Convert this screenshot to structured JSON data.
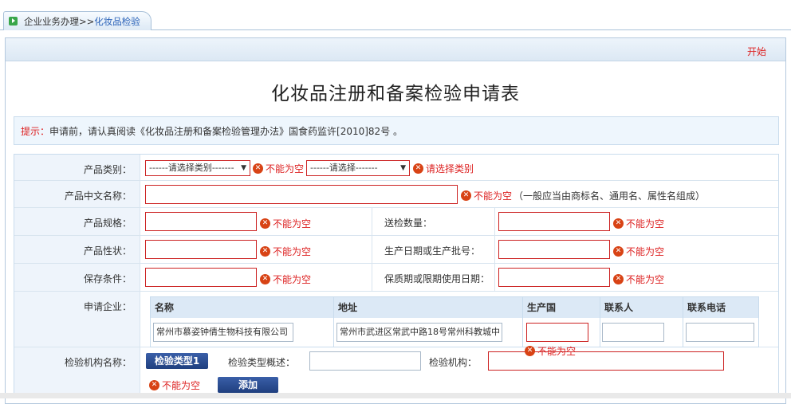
{
  "tab": {
    "crumb": "企业业务办理>>",
    "current": "化妆品检验"
  },
  "toolbar": {
    "start_label": "开始"
  },
  "title": "化妆品注册和备案检验申请表",
  "notice": {
    "label": "提示：",
    "text": "申请前，请认真阅读《化妆品注册和备案检验管理办法》国食药监许[2010]82号 。"
  },
  "errors": {
    "required": "不能为空",
    "select_category": "请选择类别"
  },
  "form": {
    "category": {
      "label": "产品类别：",
      "select1": "------请选择类别-------",
      "select2": "------请选择-------"
    },
    "cn_name": {
      "label": "产品中文名称：",
      "hint": "（一般应当由商标名、通用名、属性名组成）"
    },
    "spec": {
      "label": "产品规格："
    },
    "qty": {
      "label": "送检数量："
    },
    "nature": {
      "label": "产品性状："
    },
    "batch": {
      "label": "生产日期或生产批号："
    },
    "storage": {
      "label": "保存条件："
    },
    "shelf": {
      "label": "保质期或限期使用日期："
    },
    "company": {
      "label": "申请企业：",
      "headers": [
        "名称",
        "地址",
        "生产国",
        "联系人",
        "联系电话"
      ],
      "name_value": "常州市慕姿钟倩生物科技有限公司",
      "address_value": "常州市武进区常武中路18号常州科教城中"
    },
    "agency": {
      "label": "检验机构名称：",
      "type_button": "检验类型1",
      "type_desc_label": "检验类型概述：",
      "agency_label": "检验机构：",
      "add_button": "添加"
    }
  }
}
